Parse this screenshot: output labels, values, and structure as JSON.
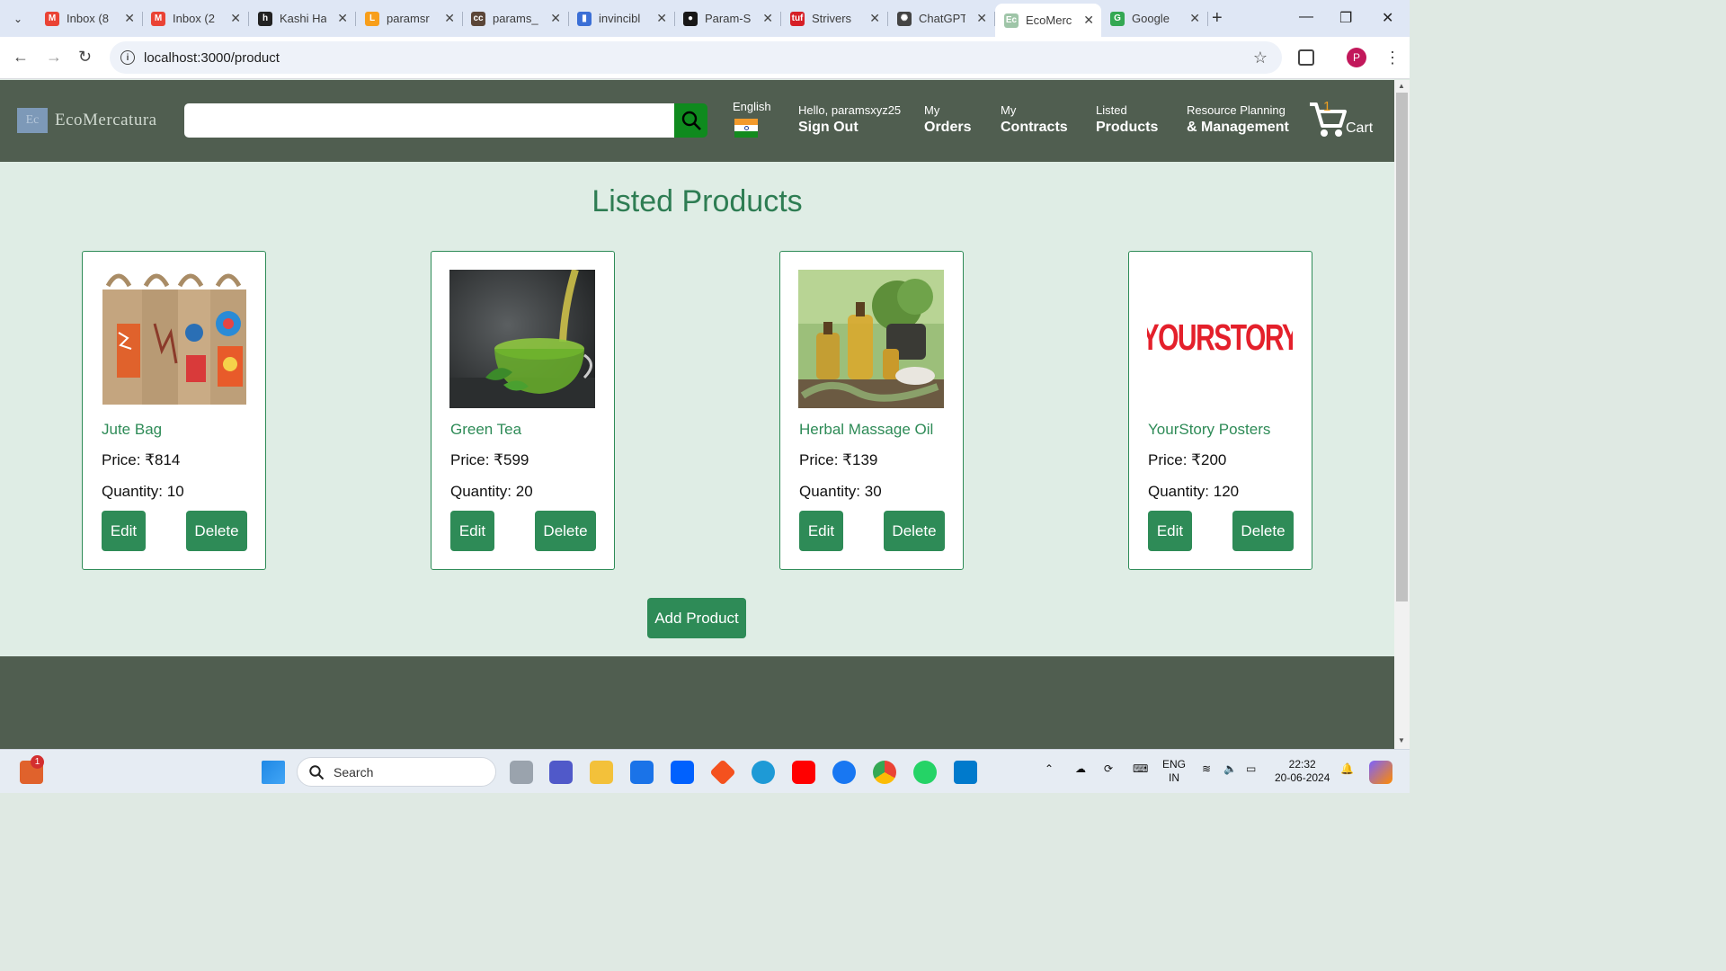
{
  "browser": {
    "tabs": [
      {
        "label": "Inbox (8",
        "icon": "gmail-icon",
        "color": "#ea4335",
        "glyph": "M"
      },
      {
        "label": "Inbox (2",
        "icon": "gmail-icon",
        "color": "#ea4335",
        "glyph": "M"
      },
      {
        "label": "Kashi Ha",
        "icon": "hashnode-icon",
        "color": "#222222",
        "glyph": "h"
      },
      {
        "label": "paramsr",
        "icon": "leetcode-icon",
        "color": "#f89f1b",
        "glyph": "L"
      },
      {
        "label": "params_",
        "icon": "codechef-icon",
        "color": "#5b4638",
        "glyph": "cc"
      },
      {
        "label": "invincibl",
        "icon": "chart-icon",
        "color": "#3b6fd6",
        "glyph": "▮"
      },
      {
        "label": "Param-S",
        "icon": "github-icon",
        "color": "#181717",
        "glyph": "●"
      },
      {
        "label": "Strivers",
        "icon": "tuf-icon",
        "color": "#d61f26",
        "glyph": "tuf"
      },
      {
        "label": "ChatGPT",
        "icon": "chatgpt-icon",
        "color": "#444444",
        "glyph": "✺"
      },
      {
        "label": "EcoMerc",
        "icon": "ecomercatura-icon",
        "color": "#9fc5a8",
        "glyph": "Ec",
        "active": true
      },
      {
        "label": "Google",
        "icon": "google-maps-icon",
        "color": "#34a853",
        "glyph": "G"
      }
    ],
    "url": "localhost:3000/product"
  },
  "header": {
    "brand": "EcoMercatura",
    "logo_mark": "Ec",
    "search_placeholder": "",
    "language": "English",
    "greeting": "Hello, paramsxyz25",
    "sign_out": "Sign Out",
    "nav": [
      {
        "small": "My",
        "big": "Orders"
      },
      {
        "small": "My",
        "big": "Contracts"
      },
      {
        "small": "Listed",
        "big": "Products"
      },
      {
        "small": "Resource Planning",
        "big": "& Management"
      }
    ],
    "cart_count": "1",
    "cart_label": "Cart"
  },
  "main": {
    "title": "Listed Products",
    "products": [
      {
        "name": "Jute Bag",
        "price": "Price: ₹814",
        "quantity": "Quantity: 10",
        "image": "jute-bag-image"
      },
      {
        "name": "Green Tea",
        "price": "Price: ₹599",
        "quantity": "Quantity: 20",
        "image": "green-tea-image"
      },
      {
        "name": "Herbal Massage Oil",
        "price": "Price: ₹139",
        "quantity": "Quantity: 30",
        "image": "herbal-oil-image"
      },
      {
        "name": "YourStory Posters",
        "price": "Price: ₹200",
        "quantity": "Quantity: 120",
        "image": "yourstory-logo-image",
        "logo_text": "YOURSTORY"
      }
    ],
    "edit_label": "Edit",
    "delete_label": "Delete",
    "add_product_label": "Add Product"
  },
  "taskbar": {
    "search_label": "Search",
    "lang_top": "ENG",
    "lang_bottom": "IN",
    "time": "22:32",
    "date": "20-06-2024",
    "notification_badge": "1"
  },
  "colors": {
    "header_bg": "#505e50",
    "accent": "#2e8b57",
    "page_bg": "#dfede5"
  }
}
